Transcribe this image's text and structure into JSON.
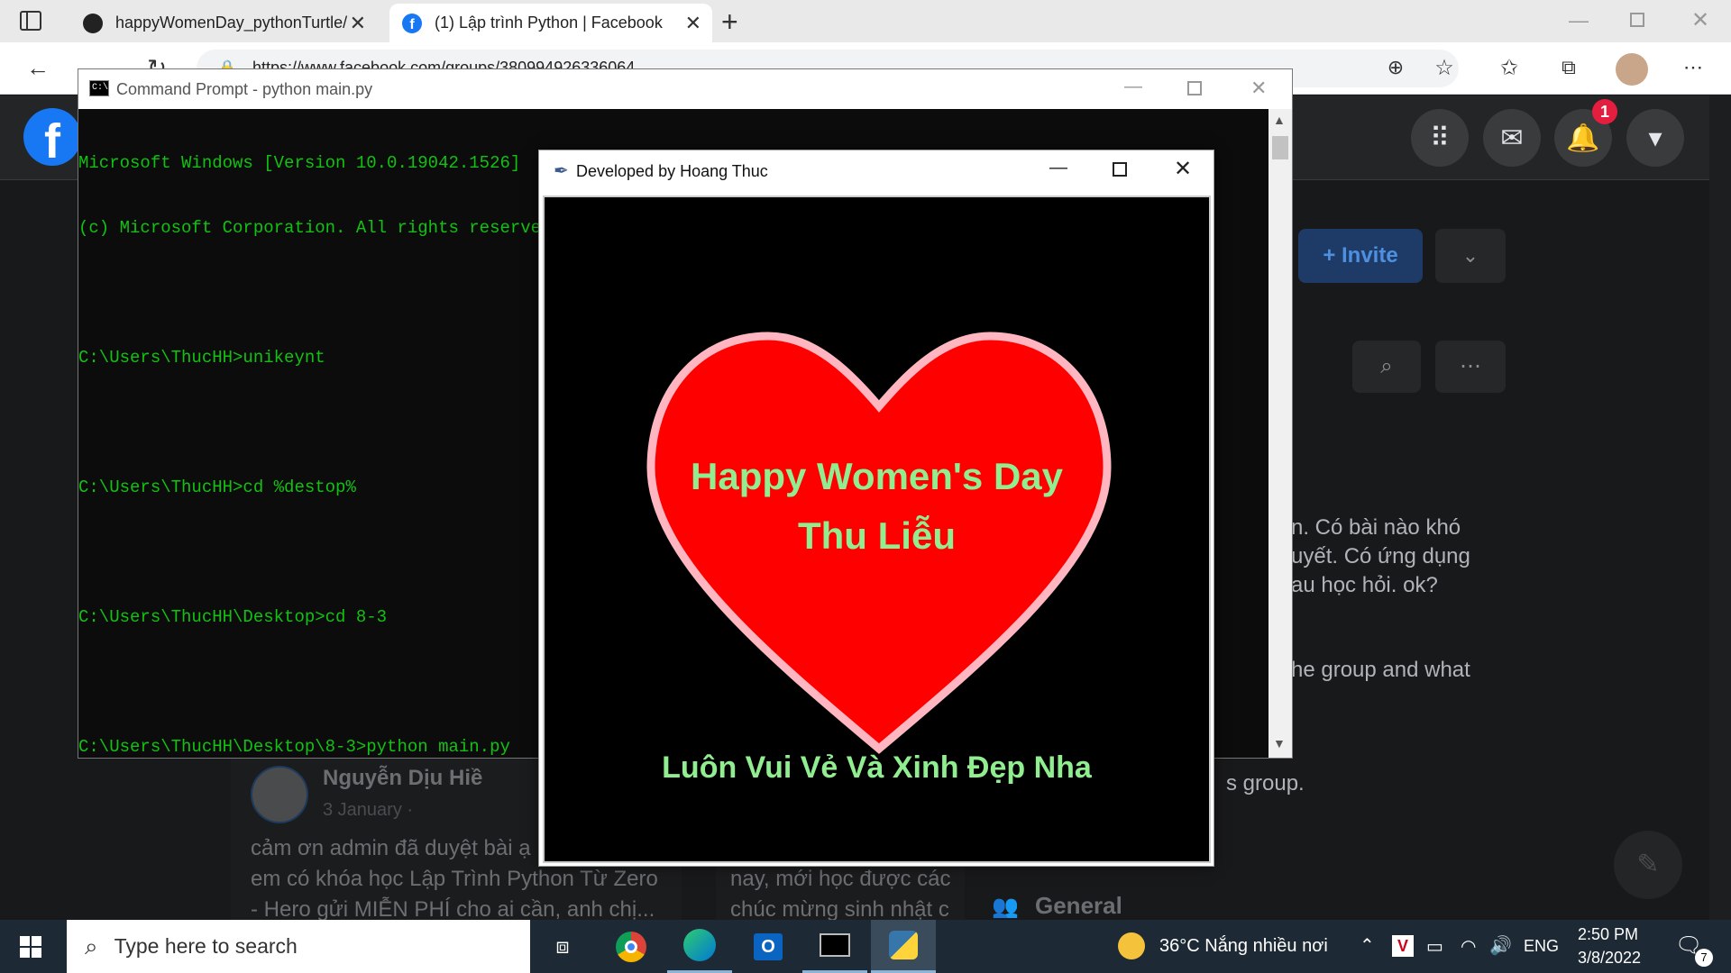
{
  "browser": {
    "tabs": [
      {
        "title": "happyWomenDay_pythonTurtle/",
        "icon": "github-icon"
      },
      {
        "title": "(1) Lập trình Python | Facebook",
        "icon": "facebook-icon"
      }
    ],
    "url": "https://www.facebook.com/groups/380994926336064..."
  },
  "facebook": {
    "notification_count": "1",
    "invite_label": "+ Invite",
    "about_lines": [
      "n. Có bài nào khó",
      "uyết. Có ứng dụng",
      "au học hỏi. ok?"
    ],
    "group_text": "he group and what",
    "group_text2": "s group.",
    "post_author": "Nguyễn Dịu Hiề",
    "post_date": "3 January ·",
    "post_text": [
      "cảm ơn admin đã duyệt bài ạ",
      "em có khóa học Lập Trình Python Từ Zero",
      "- Hero gửi MIỄN PHÍ cho ai cần, anh chị..."
    ],
    "post2_text": [
      "nay, mới học được các",
      "chúc mừng sinh nhật c"
    ],
    "section_label": "General"
  },
  "cmd": {
    "title": "Command Prompt - python  main.py",
    "lines": [
      "Microsoft Windows [Version 10.0.19042.1526]",
      "(c) Microsoft Corporation. All rights reserved.",
      "",
      "C:\\Users\\ThucHH>unikeynt",
      "",
      "C:\\Users\\ThucHH>cd %destop%",
      "",
      "C:\\Users\\ThucHH\\Desktop>cd 8-3",
      "",
      "C:\\Users\\ThucHH\\Desktop\\8-3>python main.py"
    ]
  },
  "turtle": {
    "title": "Developed by Hoang Thuc",
    "heading": "Happy Women's Day",
    "name": "Thu Liễu",
    "wish": "Luôn Vui Vẻ Và Xinh Đẹp Nha",
    "colors": {
      "heart_fill": "#ff0000",
      "heart_border": "#ffb6c1",
      "text": "#90ee90",
      "canvas": "#000000"
    }
  },
  "taskbar": {
    "search_placeholder": "Type here to search",
    "weather": "36°C  Nắng nhiều nơi",
    "language": "ENG",
    "time": "2:50 PM",
    "date": "3/8/2022",
    "notif_count": "7"
  }
}
